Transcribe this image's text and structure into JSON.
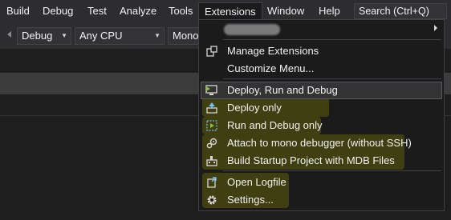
{
  "menubar": {
    "items": [
      {
        "label": "Build"
      },
      {
        "label": "Debug"
      },
      {
        "label": "Test"
      },
      {
        "label": "Analyze"
      },
      {
        "label": "Tools"
      },
      {
        "label": "Extensions"
      },
      {
        "label": "Window"
      },
      {
        "label": "Help"
      }
    ],
    "search_placeholder": "Search (Ctrl+Q)"
  },
  "toolbar": {
    "configuration": "Debug",
    "platform": "Any CPU",
    "startup_project": "Monol"
  },
  "extensions_menu": {
    "items": [
      {
        "label": "Manage Extensions",
        "icon": "manage-extensions-icon"
      },
      {
        "label": "Customize Menu...",
        "icon": null
      },
      {
        "label": "Deploy, Run and Debug",
        "icon": "monitor-run-icon"
      },
      {
        "label": "Deploy only",
        "icon": "deploy-upload-icon"
      },
      {
        "label": "Run and Debug only",
        "icon": "run-debug-icon"
      },
      {
        "label": "Attach to mono debugger (without SSH)",
        "icon": "attach-debugger-icon"
      },
      {
        "label": "Build Startup Project with MDB Files",
        "icon": "build-factory-icon"
      },
      {
        "label": "Open Logfile",
        "icon": "open-logfile-icon"
      },
      {
        "label": "Settings...",
        "icon": "gear-icon"
      }
    ]
  },
  "colors": {
    "menubar_bg": "#2d2d30",
    "menu_bg": "#1b1b1c",
    "highlight_yellow": "#3f3f12",
    "icon_green": "#8bbf3c",
    "icon_blue": "#75bdee"
  }
}
